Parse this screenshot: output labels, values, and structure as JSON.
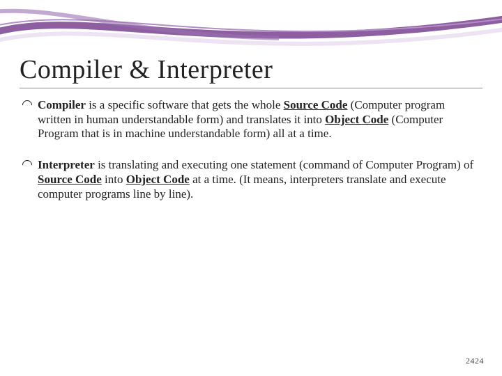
{
  "title": "Compiler & Interpreter",
  "bullets": {
    "b1": {
      "t1": "Compiler",
      "t2": " is a specific software that gets the whole ",
      "t3": "Source Code",
      "t4": " (Computer program written in human understandable form) and translates it into ",
      "t5": "Object Code",
      "t6": " (Computer Program that is in machine understandable form) all at a time."
    },
    "b2": {
      "t1": "Interpreter",
      "t2": " is translating and executing one statement (command of Computer Program) of ",
      "t3": "Source Code",
      "t4": " into ",
      "t5": "Object Code",
      "t6": " at a time. (It means, interpreters translate and execute computer programs line by line)."
    }
  },
  "pagenum": "2424"
}
